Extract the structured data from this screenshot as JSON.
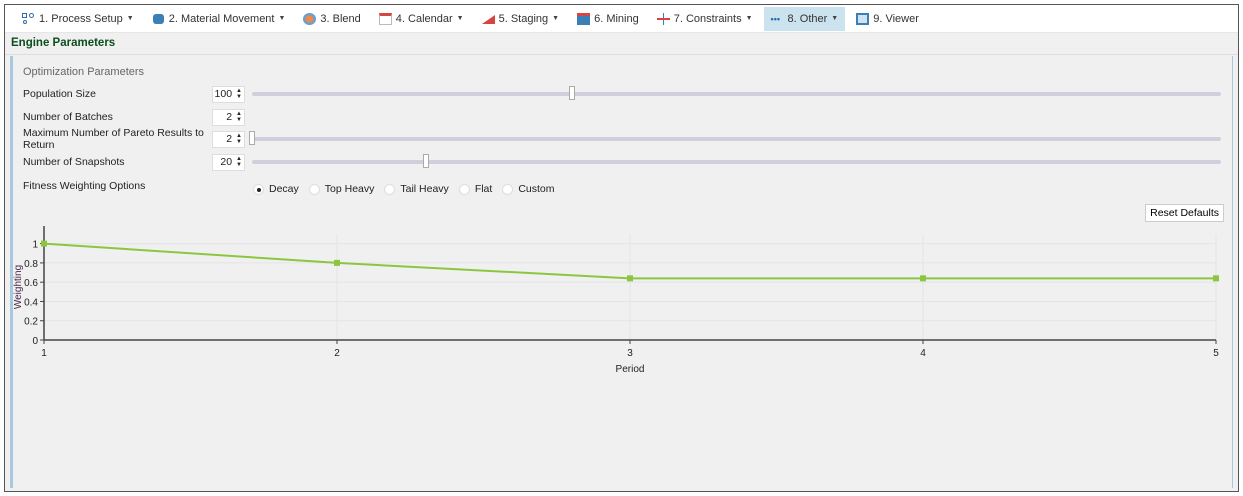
{
  "toolbar": {
    "items": [
      {
        "label": "1. Process Setup",
        "icon": "process-setup-icon",
        "dropdown": true
      },
      {
        "label": "2. Material Movement",
        "icon": "material-movement-icon",
        "dropdown": true
      },
      {
        "label": "3. Blend",
        "icon": "blend-icon",
        "dropdown": false
      },
      {
        "label": "4. Calendar",
        "icon": "calendar-icon",
        "dropdown": true
      },
      {
        "label": "5. Staging",
        "icon": "staging-icon",
        "dropdown": true
      },
      {
        "label": "6. Mining",
        "icon": "mining-icon",
        "dropdown": false
      },
      {
        "label": "7. Constraints",
        "icon": "constraints-icon",
        "dropdown": true
      },
      {
        "label": "8. Other",
        "icon": "more-dots-icon",
        "dropdown": true,
        "active": true
      },
      {
        "label": "9. Viewer",
        "icon": "viewer-icon",
        "dropdown": false
      }
    ]
  },
  "header": {
    "title": "Engine Parameters"
  },
  "params": {
    "section": "Optimization Parameters",
    "population": {
      "label": "Population Size",
      "value": "100",
      "slider_fraction": 0.33
    },
    "batches": {
      "label": "Number of Batches",
      "value": "2"
    },
    "pareto": {
      "label": "Maximum Number of Pareto Results to Return",
      "value": "2",
      "slider_fraction": 0.0
    },
    "snapshots": {
      "label": "Number of Snapshots",
      "value": "20",
      "slider_fraction": 0.18
    },
    "fitness": {
      "label": "Fitness Weighting Options",
      "options": [
        "Decay",
        "Top Heavy",
        "Tail Heavy",
        "Flat",
        "Custom"
      ],
      "selected": "Decay"
    },
    "reset_label": "Reset Defaults"
  },
  "colors": {
    "line": "#8cc63f",
    "accent": "#0b4d1e"
  },
  "chart_data": {
    "type": "line",
    "x": [
      1,
      2,
      3,
      4,
      5
    ],
    "series": [
      {
        "name": "Weighting",
        "values": [
          1,
          0.8,
          0.64,
          0.64,
          0.64
        ]
      }
    ],
    "xlabel": "Period",
    "ylabel": "Weighting",
    "xlim": [
      1,
      5
    ],
    "ylim": [
      0,
      1.1
    ],
    "xticks": [
      "1",
      "2",
      "3",
      "4",
      "5"
    ],
    "yticks": [
      "0",
      "0.2",
      "0.4",
      "0.6",
      "0.8",
      "1"
    ],
    "grid": true
  }
}
